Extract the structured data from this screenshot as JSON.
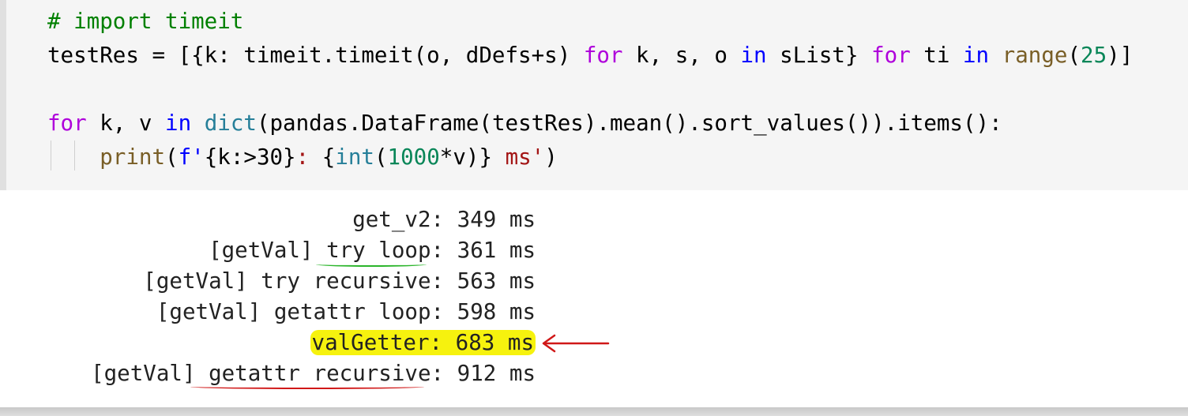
{
  "code_cell": {
    "lines": [
      {
        "tokens": [
          {
            "t": "# import timeit",
            "c": "cm"
          }
        ]
      },
      {
        "tokens": [
          {
            "t": "testRes = [{k: timeit.timeit(o, dDefs+s) ",
            "c": ""
          },
          {
            "t": "for",
            "c": "kw"
          },
          {
            "t": " k, s, o ",
            "c": ""
          },
          {
            "t": "in",
            "c": "kw2"
          },
          {
            "t": " sList} ",
            "c": ""
          },
          {
            "t": "for",
            "c": "kw"
          },
          {
            "t": " ti ",
            "c": ""
          },
          {
            "t": "in",
            "c": "kw2"
          },
          {
            "t": " ",
            "c": ""
          },
          {
            "t": "range",
            "c": "fn"
          },
          {
            "t": "(",
            "c": ""
          },
          {
            "t": "25",
            "c": "num"
          },
          {
            "t": ")]",
            "c": ""
          }
        ]
      },
      {
        "tokens": []
      },
      {
        "tokens": [
          {
            "t": "for",
            "c": "kw"
          },
          {
            "t": " k, v ",
            "c": ""
          },
          {
            "t": "in",
            "c": "kw2"
          },
          {
            "t": " ",
            "c": ""
          },
          {
            "t": "dict",
            "c": "bi"
          },
          {
            "t": "(pandas.DataFrame(testRes).mean().sort_values()).items():",
            "c": ""
          }
        ]
      },
      {
        "tokens": [
          {
            "t": "    ",
            "c": ""
          },
          {
            "t": "print",
            "c": "fn"
          },
          {
            "t": "(",
            "c": ""
          },
          {
            "t": "f'",
            "c": "kw2"
          },
          {
            "t": "{k:>30}",
            "c": ""
          },
          {
            "t": ": ",
            "c": "str"
          },
          {
            "t": "{",
            "c": ""
          },
          {
            "t": "int",
            "c": "bi"
          },
          {
            "t": "(",
            "c": ""
          },
          {
            "t": "1000",
            "c": "num"
          },
          {
            "t": "*v)}",
            "c": ""
          },
          {
            "t": " ms'",
            "c": "str"
          },
          {
            "t": ")",
            "c": ""
          }
        ]
      }
    ]
  },
  "output": {
    "rows": [
      {
        "label": "get_v2",
        "value": "349 ms"
      },
      {
        "label": "[getVal] try loop",
        "value": "361 ms"
      },
      {
        "label": "[getVal] try recursive",
        "value": "563 ms"
      },
      {
        "label": "[getVal] getattr loop",
        "value": "598 ms"
      },
      {
        "label": "valGetter",
        "value": "683 ms"
      },
      {
        "label": "[getVal] getattr recursive",
        "value": "912 ms"
      }
    ],
    "separator": ": "
  },
  "annotations": {
    "highlight_color": "#f6f20e",
    "green_underline_color": "#2bb52b",
    "red_mark_color": "#d01818"
  }
}
